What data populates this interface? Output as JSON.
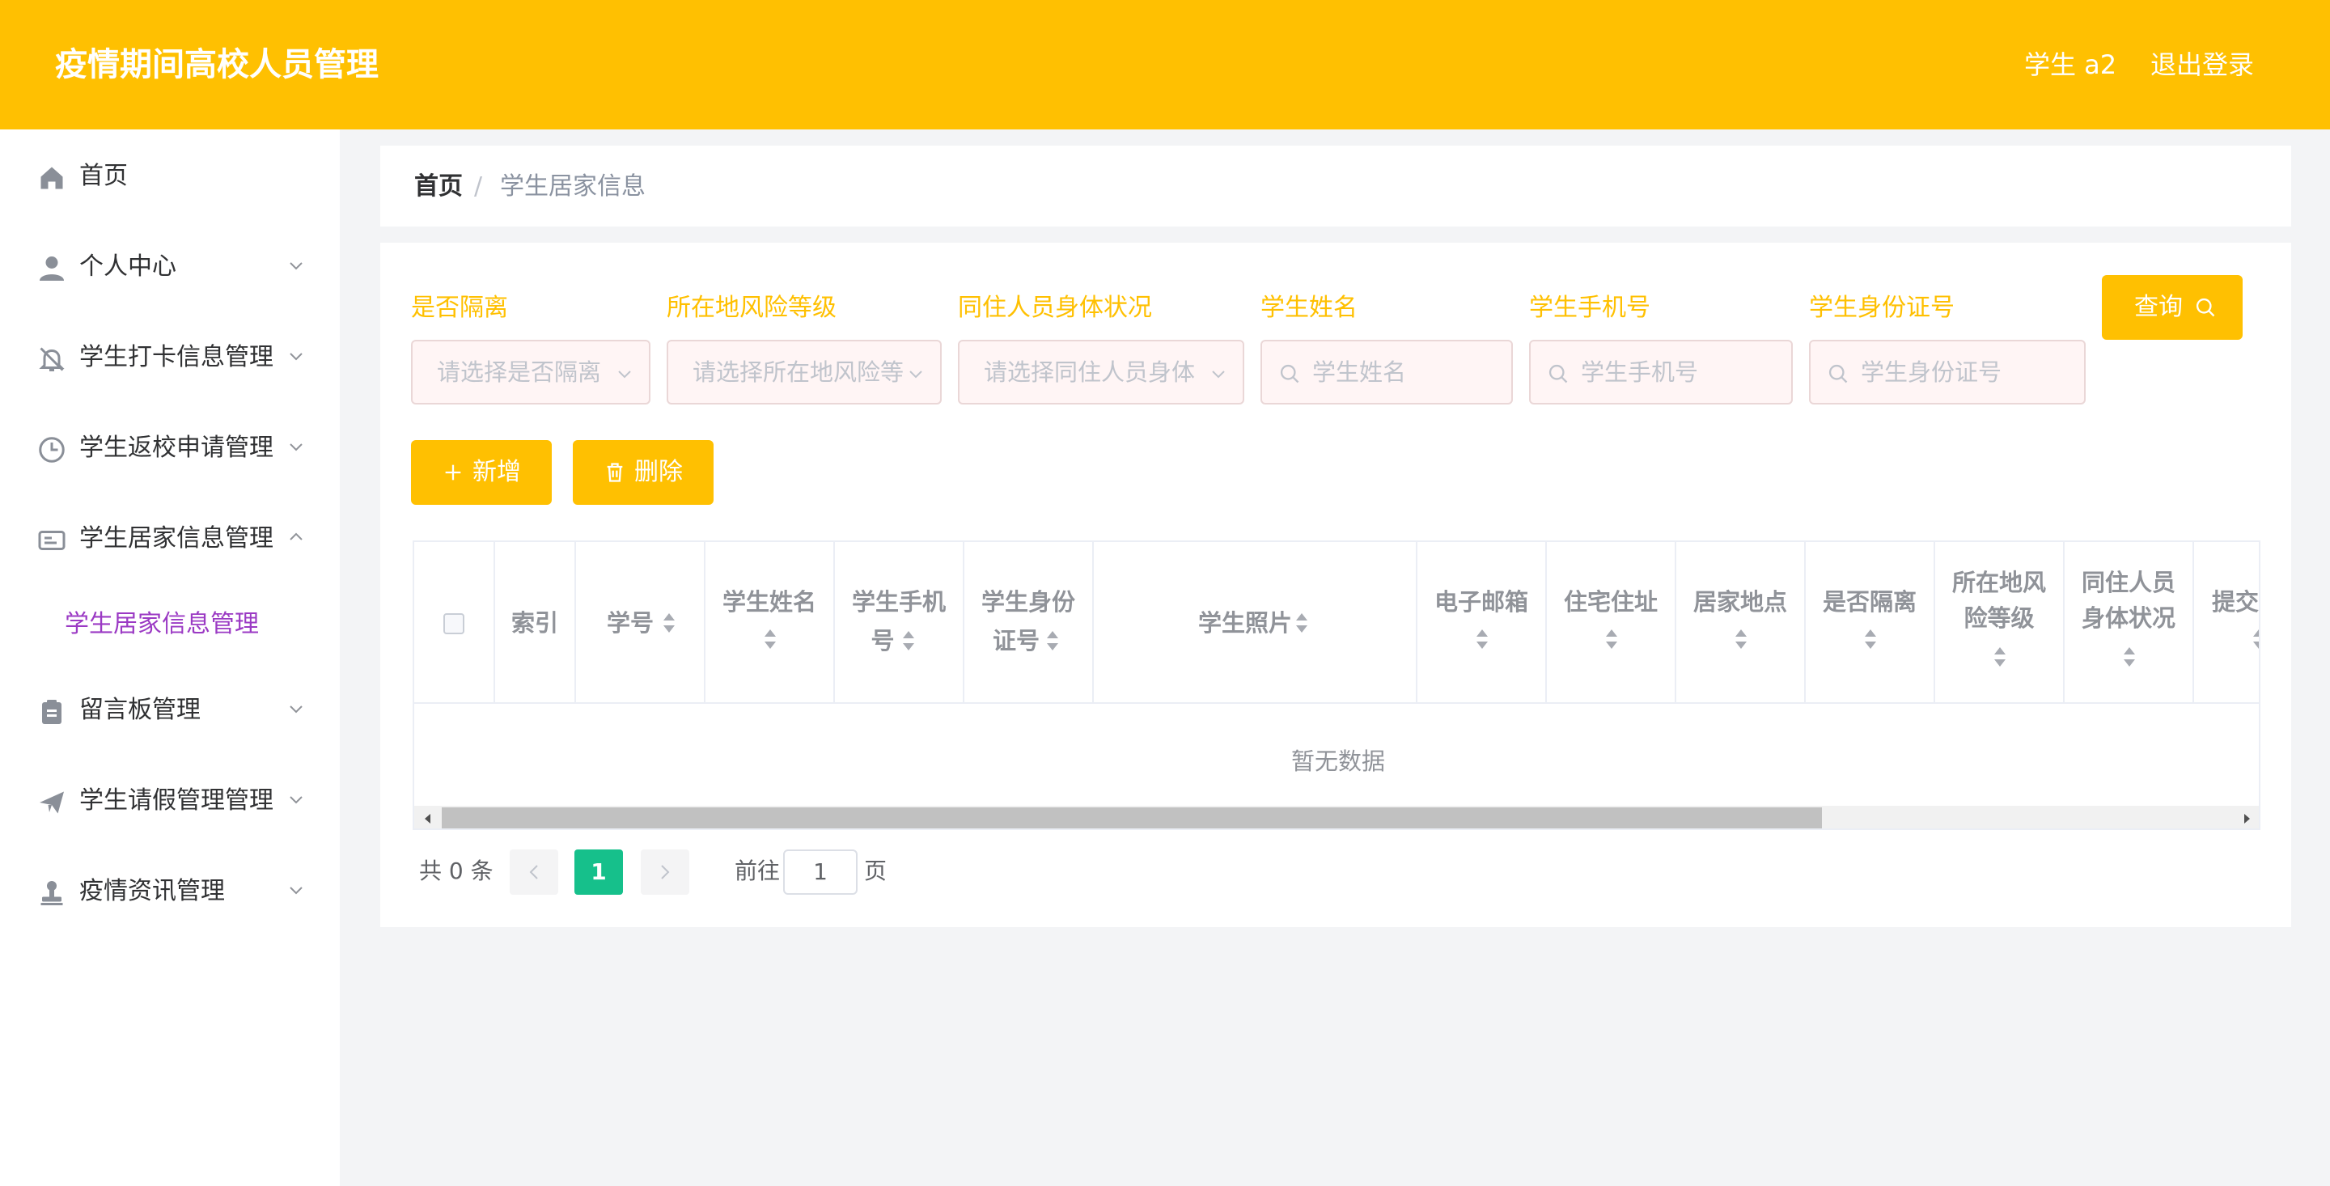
{
  "header": {
    "title": "疫情期间高校人员管理",
    "user": "学生 a2",
    "logout": "退出登录",
    "background_color": "#ffc001"
  },
  "sidebar": {
    "items": [
      {
        "label": "首页",
        "icon": "home-icon",
        "expandable": false
      },
      {
        "label": "个人中心",
        "icon": "user-icon",
        "expandable": true
      },
      {
        "label": "学生打卡信息管理",
        "icon": "bell-off-icon",
        "expandable": true
      },
      {
        "label": "学生返校申请管理",
        "icon": "clock-icon",
        "expandable": true
      },
      {
        "label": "学生居家信息管理",
        "icon": "id-card-icon",
        "expandable": true,
        "expanded": true
      },
      {
        "label": "留言板管理",
        "icon": "clipboard-icon",
        "expandable": true
      },
      {
        "label": "学生请假管理管理",
        "icon": "paper-plane-icon",
        "expandable": true
      },
      {
        "label": "疫情资讯管理",
        "icon": "stamp-icon",
        "expandable": true
      }
    ],
    "submenu": {
      "label": "学生居家信息管理",
      "color": "#9b3ac4"
    }
  },
  "breadcrumb": {
    "home": "首页",
    "separator": "/",
    "current": "学生居家信息"
  },
  "filters": {
    "isolation": {
      "label": "是否隔离",
      "placeholder": "请选择是否隔离"
    },
    "risk_level": {
      "label": "所在地风险等级",
      "placeholder": "请选择所在地风险等"
    },
    "cohabitant_health": {
      "label": "同住人员身体状况",
      "placeholder": "请选择同住人员身体"
    },
    "student_name": {
      "label": "学生姓名",
      "placeholder": "学生姓名"
    },
    "student_phone": {
      "label": "学生手机号",
      "placeholder": "学生手机号"
    },
    "student_id_card": {
      "label": "学生身份证号",
      "placeholder": "学生身份证号"
    },
    "label_color": "#ffc001"
  },
  "actions": {
    "query": "查询",
    "add": "新增",
    "delete": "删除"
  },
  "table": {
    "columns": [
      {
        "label": "索引"
      },
      {
        "label": "学号"
      },
      {
        "label": "学生姓名"
      },
      {
        "label": "学生手机号"
      },
      {
        "label": "学生身份证号"
      },
      {
        "label": "学生照片"
      },
      {
        "label": "电子邮箱"
      },
      {
        "label": "住宅住址"
      },
      {
        "label": "居家地点"
      },
      {
        "label": "是否隔离"
      },
      {
        "label": "所在地风险等级"
      },
      {
        "label": "同住人员身体状况"
      },
      {
        "label": "提交"
      }
    ],
    "col_lines": {
      "student_name": [
        "学生姓名"
      ],
      "student_phone": [
        "学生手机",
        "号"
      ],
      "student_id_card": [
        "学生身份",
        "证号"
      ],
      "risk_level": [
        "所在地风",
        "险等级"
      ],
      "cohabitant_health": [
        "同住人员",
        "身体状况"
      ]
    },
    "empty_text": "暂无数据",
    "rows": []
  },
  "pagination": {
    "total": "共 0 条",
    "current_page": "1",
    "goto_label": "前往",
    "goto_value": "1",
    "page_suffix": "页",
    "active_color": "#16c08b"
  }
}
